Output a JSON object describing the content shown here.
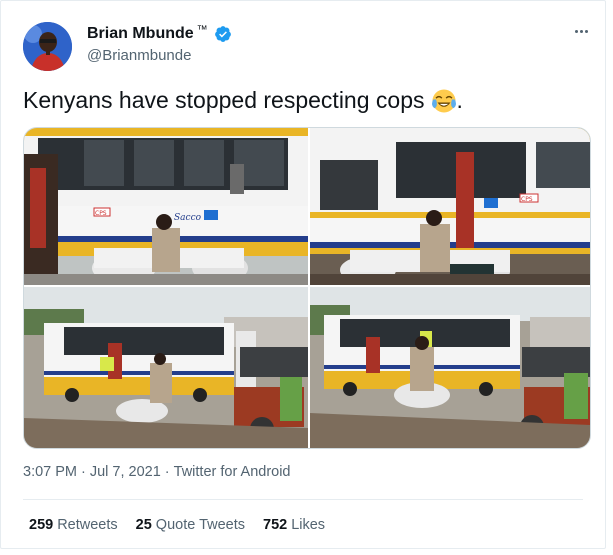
{
  "author": {
    "display_name": "Brian Mbunde",
    "tm": "™",
    "handle": "@Brianmbunde",
    "verified": true
  },
  "tweet": {
    "text": "Kenyans have stopped respecting cops",
    "trailing": ".",
    "emoji": "face-with-tears-of-joy"
  },
  "media": {
    "count": 4,
    "bus_text": "Sacco",
    "bus_badge": "CPS"
  },
  "meta": {
    "time": "3:07 PM",
    "sep1": "·",
    "date": "Jul 7, 2021",
    "sep2": "·",
    "source": "Twitter for Android"
  },
  "stats": {
    "retweets": "259",
    "retweets_label": "Retweets",
    "quotes": "25",
    "quotes_label": "Quote Tweets",
    "likes": "752",
    "likes_label": "Likes"
  },
  "colors": {
    "accent": "#1d9bf0",
    "bus_yellow": "#e9b526",
    "bus_blue": "#243e8c"
  }
}
